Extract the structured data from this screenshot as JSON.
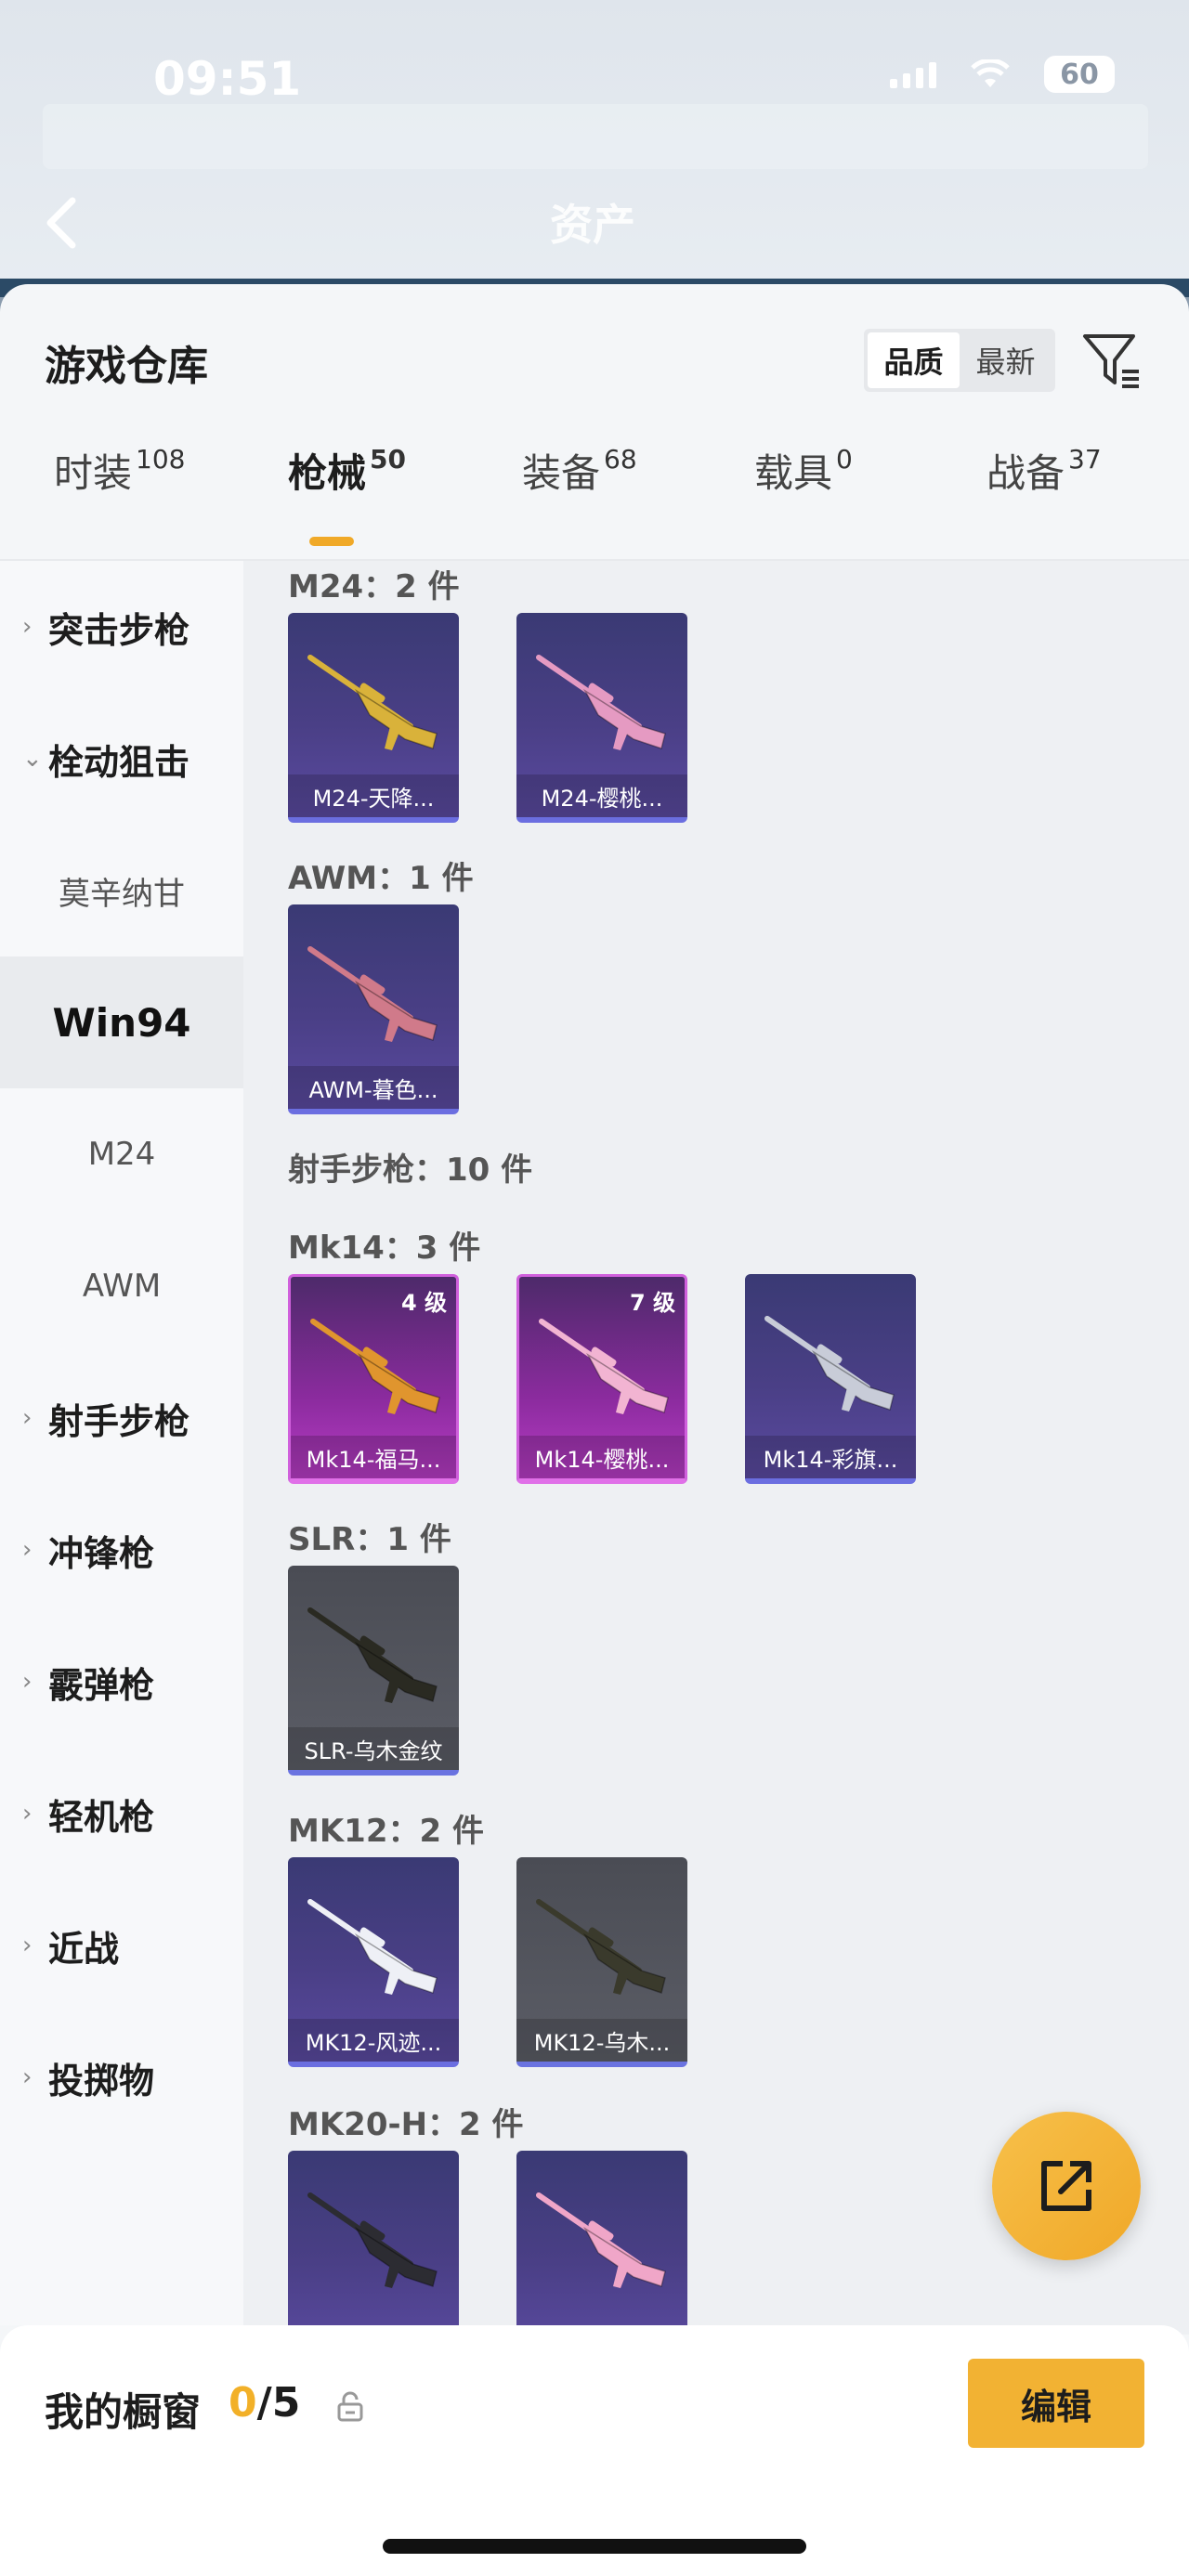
{
  "status": {
    "time": "09:51",
    "battery": "60"
  },
  "background_page": {
    "title": "资产"
  },
  "sheet": {
    "title": "游戏仓库",
    "sort_options": [
      "品质",
      "最新"
    ],
    "tabs": [
      {
        "label": "时装",
        "count": "108"
      },
      {
        "label": "枪械",
        "count": "50"
      },
      {
        "label": "装备",
        "count": "68"
      },
      {
        "label": "载具",
        "count": "0"
      },
      {
        "label": "战备",
        "count": "37"
      }
    ]
  },
  "sidebar": {
    "items": [
      {
        "label": "突击步枪",
        "type": "category",
        "chevron": "›"
      },
      {
        "label": "栓动狙击",
        "type": "category",
        "chevron": "⌄"
      },
      {
        "label": "莫辛纳甘",
        "type": "sub"
      },
      {
        "label": "Win94",
        "type": "sub"
      },
      {
        "label": "M24",
        "type": "sub"
      },
      {
        "label": "AWM",
        "type": "sub"
      },
      {
        "label": "射手步枪",
        "type": "category",
        "chevron": "›"
      },
      {
        "label": "冲锋枪",
        "type": "category",
        "chevron": "›"
      },
      {
        "label": "霰弹枪",
        "type": "category",
        "chevron": "›"
      },
      {
        "label": "轻机枪",
        "type": "category",
        "chevron": "›"
      },
      {
        "label": "近战",
        "type": "category",
        "chevron": "›"
      },
      {
        "label": "投掷物",
        "type": "category",
        "chevron": "›"
      }
    ]
  },
  "content": {
    "groups": [
      {
        "label": "M24：2 件"
      },
      {
        "label": "AWM：1 件"
      },
      {
        "label": "射手步枪：10 件"
      },
      {
        "label": "Mk14：3 件"
      },
      {
        "label": "SLR：1 件"
      },
      {
        "label": "MK12：2 件"
      },
      {
        "label": "MK20-H：2 件"
      }
    ],
    "items": [
      {
        "name": "M24-天降...",
        "level": "",
        "rarity": "purple",
        "gun_color": "#d9b23a"
      },
      {
        "name": "M24-樱桃...",
        "level": "",
        "rarity": "purple",
        "gun_color": "#e59ac2"
      },
      {
        "name": "AWM-暮色...",
        "level": "",
        "rarity": "purple",
        "gun_color": "#d07a8a"
      },
      {
        "name": "Mk14-福马...",
        "level": "4 级",
        "rarity": "pink",
        "gun_color": "#e0952e"
      },
      {
        "name": "Mk14-樱桃...",
        "level": "7 级",
        "rarity": "pink",
        "gun_color": "#f2b4d2"
      },
      {
        "name": "Mk14-彩旗...",
        "level": "",
        "rarity": "purple",
        "gun_color": "#c8ccd8"
      },
      {
        "name": "SLR-乌木金纹",
        "level": "",
        "rarity": "gray",
        "gun_color": "#2a2a22"
      },
      {
        "name": "MK12-风迹...",
        "level": "",
        "rarity": "purple",
        "gun_color": "#eef0f6"
      },
      {
        "name": "MK12-乌木...",
        "level": "",
        "rarity": "gray",
        "gun_color": "#3a3a2c"
      },
      {
        "name": "",
        "level": "",
        "rarity": "purple",
        "gun_color": "#2c2c32"
      },
      {
        "name": "",
        "level": "",
        "rarity": "purple",
        "gun_color": "#f0a6c8"
      }
    ]
  },
  "showcase": {
    "title": "我的橱窗",
    "current": "0",
    "total": "/5",
    "edit_label": "编辑"
  },
  "colors": {
    "accent": "#f2b233",
    "purple_rarity": "#6b6ee0",
    "pink_rarity": "#d060dc"
  },
  "icons": [
    "back-arrow-icon",
    "filter-icon",
    "lock-icon",
    "share-icon",
    "chevron-right-icon",
    "chevron-down-icon"
  ]
}
